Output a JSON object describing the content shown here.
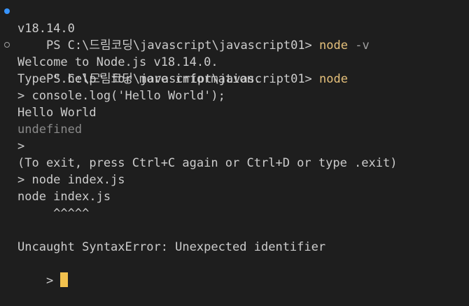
{
  "terminal": {
    "lines": [
      {
        "prompt": "PS C:\\드림코딩\\javascript\\javascript01> ",
        "command": "node",
        "args": " -v",
        "marker": "filled"
      },
      {
        "text": "v18.14.0"
      },
      {
        "prompt": "PS C:\\드림코딩\\javascript\\javascript01> ",
        "command": "node",
        "marker": "hollow"
      },
      {
        "text": "Welcome to Node.js v18.14.0."
      },
      {
        "text": "Type \".help\" for more information."
      },
      {
        "text": "> console.log('Hello World');"
      },
      {
        "text": "Hello World"
      },
      {
        "text": "undefined",
        "dim": true
      },
      {
        "text": ">"
      },
      {
        "text": "(To exit, press Ctrl+C again or Ctrl+D or type .exit)"
      },
      {
        "text": "> node index.js"
      },
      {
        "text": "node index.js"
      },
      {
        "text": "     ^^^^^"
      },
      {
        "text": ""
      },
      {
        "text": "Uncaught SyntaxError: Unexpected identifier"
      },
      {
        "text": "> ",
        "cursor": true
      }
    ]
  },
  "colors": {
    "background": "#1e1e1e",
    "foreground": "#cccccc",
    "command": "#e5c07b",
    "marker_success": "#3794ff",
    "cursor": "#f2c14e"
  }
}
